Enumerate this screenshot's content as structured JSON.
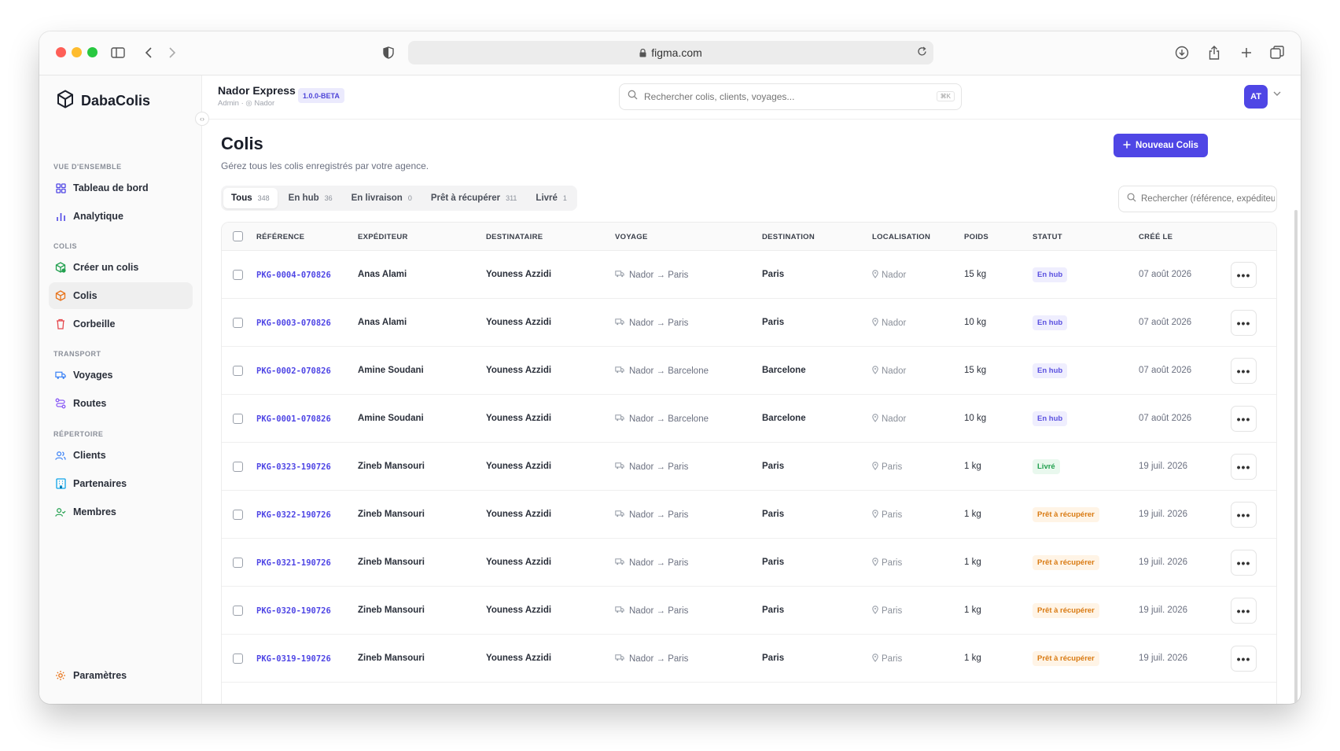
{
  "browser": {
    "url": "figma.com"
  },
  "sidebar": {
    "brand": "DabaColis",
    "sections": [
      {
        "label": "VUE D'ENSEMBLE"
      },
      {
        "label": "COLIS"
      },
      {
        "label": "TRANSPORT"
      },
      {
        "label": "RÉPERTOIRE"
      }
    ],
    "items": [
      {
        "label": "Tableau de bord",
        "icon": "grid-icon",
        "color": "#4f46e5"
      },
      {
        "label": "Analytique",
        "icon": "bar-chart-icon",
        "color": "#4f46e5"
      },
      {
        "label": "Créer un colis",
        "icon": "package-plus-icon",
        "color": "#22a04f"
      },
      {
        "label": "Colis",
        "icon": "package-icon",
        "color": "#e8731a"
      },
      {
        "label": "Corbeille",
        "icon": "trash-icon",
        "color": "#e5484d"
      },
      {
        "label": "Voyages",
        "icon": "truck-icon",
        "color": "#3b82f6"
      },
      {
        "label": "Routes",
        "icon": "route-icon",
        "color": "#8b5cf6"
      },
      {
        "label": "Clients",
        "icon": "users-icon",
        "color": "#3b82f6"
      },
      {
        "label": "Partenaires",
        "icon": "building-icon",
        "color": "#0ea5e9"
      },
      {
        "label": "Membres",
        "icon": "user-check-icon",
        "color": "#22a04f"
      }
    ],
    "settings_label": "Paramètres"
  },
  "header": {
    "agency_name": "Nador Express",
    "agency_role": "Admin",
    "agency_location": "Nador",
    "version": "1.0.0-BETA",
    "search_placeholder": "Rechercher colis, clients, voyages...",
    "search_shortcut": "⌘K",
    "avatar_initials": "AT",
    "accent_color": "#4f46e5"
  },
  "main": {
    "title": "Colis",
    "subtitle": "Gérez tous les colis enregistrés par votre agence.",
    "new_button_label": "Nouveau Colis",
    "tabs": [
      {
        "label": "Tous",
        "count": "348",
        "active": true
      },
      {
        "label": "En hub",
        "count": "36"
      },
      {
        "label": "En livraison",
        "count": "0"
      },
      {
        "label": "Prêt à récupérer",
        "count": "311"
      },
      {
        "label": "Livré",
        "count": "1"
      }
    ],
    "table_search_placeholder": "Rechercher (référence, expéditeur...",
    "columns": [
      "RÉFÉRENCE",
      "EXPÉDITEUR",
      "DESTINATAIRE",
      "VOYAGE",
      "DESTINATION",
      "LOCALISATION",
      "POIDS",
      "STATUT",
      "CRÉÉ LE"
    ],
    "rows": [
      {
        "ref": "PKG-0004-070826",
        "sender": "Anas Alami",
        "recipient": "Youness Azzidi",
        "voyage": "Nador → Paris",
        "destination": "Paris",
        "location": "Nador",
        "weight": "15 kg",
        "status": "En hub",
        "status_kind": "hub",
        "created": "07 août 2026"
      },
      {
        "ref": "PKG-0003-070826",
        "sender": "Anas Alami",
        "recipient": "Youness Azzidi",
        "voyage": "Nador → Paris",
        "destination": "Paris",
        "location": "Nador",
        "weight": "10 kg",
        "status": "En hub",
        "status_kind": "hub",
        "created": "07 août 2026"
      },
      {
        "ref": "PKG-0002-070826",
        "sender": "Amine Soudani",
        "recipient": "Youness Azzidi",
        "voyage": "Nador → Barcelone",
        "destination": "Barcelone",
        "location": "Nador",
        "weight": "15 kg",
        "status": "En hub",
        "status_kind": "hub",
        "created": "07 août 2026"
      },
      {
        "ref": "PKG-0001-070826",
        "sender": "Amine Soudani",
        "recipient": "Youness Azzidi",
        "voyage": "Nador → Barcelone",
        "destination": "Barcelone",
        "location": "Nador",
        "weight": "10 kg",
        "status": "En hub",
        "status_kind": "hub",
        "created": "07 août 2026"
      },
      {
        "ref": "PKG-0323-190726",
        "sender": "Zineb Mansouri",
        "recipient": "Youness Azzidi",
        "voyage": "Nador → Paris",
        "destination": "Paris",
        "location": "Paris",
        "weight": "1 kg",
        "status": "Livré",
        "status_kind": "livre",
        "created": "19 juil. 2026"
      },
      {
        "ref": "PKG-0322-190726",
        "sender": "Zineb Mansouri",
        "recipient": "Youness Azzidi",
        "voyage": "Nador → Paris",
        "destination": "Paris",
        "location": "Paris",
        "weight": "1 kg",
        "status": "Prêt à récupérer",
        "status_kind": "pret",
        "created": "19 juil. 2026"
      },
      {
        "ref": "PKG-0321-190726",
        "sender": "Zineb Mansouri",
        "recipient": "Youness Azzidi",
        "voyage": "Nador → Paris",
        "destination": "Paris",
        "location": "Paris",
        "weight": "1 kg",
        "status": "Prêt à récupérer",
        "status_kind": "pret",
        "created": "19 juil. 2026"
      },
      {
        "ref": "PKG-0320-190726",
        "sender": "Zineb Mansouri",
        "recipient": "Youness Azzidi",
        "voyage": "Nador → Paris",
        "destination": "Paris",
        "location": "Paris",
        "weight": "1 kg",
        "status": "Prêt à récupérer",
        "status_kind": "pret",
        "created": "19 juil. 2026"
      },
      {
        "ref": "PKG-0319-190726",
        "sender": "Zineb Mansouri",
        "recipient": "Youness Azzidi",
        "voyage": "Nador → Paris",
        "destination": "Paris",
        "location": "Paris",
        "weight": "1 kg",
        "status": "Prêt à récupérer",
        "status_kind": "pret",
        "created": "19 juil. 2026"
      }
    ]
  }
}
